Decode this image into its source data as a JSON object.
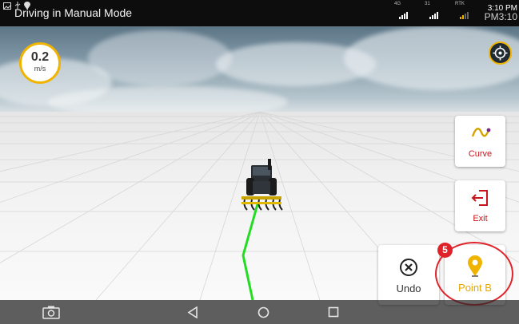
{
  "status_bar": {
    "title": "Driving in Manual Mode",
    "network_4g": "4G",
    "network_2": "31",
    "network_rtk": "RTK",
    "time_top": "3:10 PM",
    "time_bottom": "PM3:10"
  },
  "speed": {
    "value": "0.2",
    "unit": "m/s"
  },
  "side_buttons": {
    "curve_label": "Curve",
    "exit_label": "Exit"
  },
  "actions": {
    "undo_label": "Undo",
    "point_b_label": "Point B",
    "badge_count": "5"
  },
  "colors": {
    "accent": "#f0b400",
    "danger": "#c8151b",
    "track": "#22dd22"
  }
}
